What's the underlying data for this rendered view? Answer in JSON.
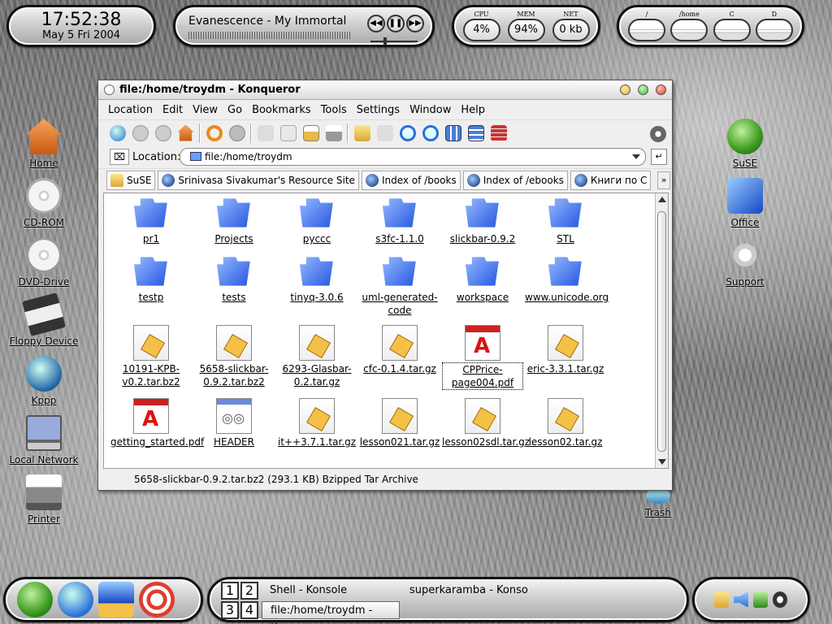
{
  "clock": {
    "time": "17:52:38",
    "date": "May 5 Fri 2004"
  },
  "player": {
    "song": "Evanescence - My Immortal",
    "buttons": [
      "rewind-icon",
      "pause-icon",
      "forward-icon"
    ]
  },
  "meters": [
    {
      "label": "CPU",
      "value": "4%"
    },
    {
      "label": "MEM",
      "value": "94%"
    },
    {
      "label": "NET",
      "value": "0 kb"
    }
  ],
  "disks": [
    {
      "label": "/"
    },
    {
      "label": "/home"
    },
    {
      "label": "C"
    },
    {
      "label": "D"
    }
  ],
  "desktop_left": [
    {
      "label": "Home",
      "icon": "home-icon"
    },
    {
      "label": "CD-ROM",
      "icon": "cdrom-icon"
    },
    {
      "label": "DVD-Drive",
      "icon": "dvd-icon"
    },
    {
      "label": "Floppy Device",
      "icon": "floppy-icon"
    },
    {
      "label": "Kppp",
      "icon": "kppp-icon"
    },
    {
      "label": "Local Network",
      "icon": "network-icon"
    },
    {
      "label": "Printer",
      "icon": "printer-icon"
    }
  ],
  "desktop_right": [
    {
      "label": "SuSE",
      "icon": "suse-icon"
    },
    {
      "label": "Office",
      "icon": "office-icon"
    },
    {
      "label": "Support",
      "icon": "support-icon"
    },
    {
      "label": "Trash",
      "icon": "trash-icon"
    }
  ],
  "window": {
    "title": "file:/home/troydm - Konqueror",
    "menu": [
      "Location",
      "Edit",
      "View",
      "Go",
      "Bookmarks",
      "Tools",
      "Settings",
      "Window",
      "Help"
    ],
    "location_label": "Location:",
    "location_value": "file:/home/troydm",
    "bookmarks": [
      "SuSE",
      "Srinivasa Sivakumar's Resource Site",
      "Index of /books",
      "Index of /ebooks",
      "Книги по С"
    ],
    "status": "5658-slickbar-0.9.2.tar.bz2 (293.1 KB)  Bzipped Tar Archive"
  },
  "files": [
    {
      "name": "pr1",
      "type": "folder"
    },
    {
      "name": "Projects",
      "type": "folder"
    },
    {
      "name": "pyccc",
      "type": "folder"
    },
    {
      "name": "s3fc-1.1.0",
      "type": "folder"
    },
    {
      "name": "slickbar-0.9.2",
      "type": "folder"
    },
    {
      "name": "STL",
      "type": "folder"
    },
    {
      "name": "testp",
      "type": "folder"
    },
    {
      "name": "tests",
      "type": "folder"
    },
    {
      "name": "tinyq-3.0.6",
      "type": "folder"
    },
    {
      "name": "uml-generated-code",
      "type": "folder"
    },
    {
      "name": "workspace",
      "type": "folder"
    },
    {
      "name": "www.unicode.org",
      "type": "folder"
    },
    {
      "name": "10191-KPB-v0.2.tar.bz2",
      "type": "tgz"
    },
    {
      "name": "5658-slickbar-0.9.2.tar.bz2",
      "type": "tgz"
    },
    {
      "name": "6293-Glasbar-0.2.tar.gz",
      "type": "tgz"
    },
    {
      "name": "cfc-0.1.4.tar.gz",
      "type": "tgz"
    },
    {
      "name": "CPPrice-page004.pdf",
      "type": "pdf",
      "selected": true
    },
    {
      "name": "eric-3.3.1.tar.gz",
      "type": "tgz"
    },
    {
      "name": "getting_started.pdf",
      "type": "pdf"
    },
    {
      "name": "HEADER",
      "type": "hdr"
    },
    {
      "name": "it++3.7.1.tar.gz",
      "type": "tgz"
    },
    {
      "name": "lesson021.tar.gz",
      "type": "tgz"
    },
    {
      "name": "lesson02sdl.tar.gz",
      "type": "tgz"
    },
    {
      "name": "lesson02.tar.gz",
      "type": "tgz"
    }
  ],
  "taskbar": {
    "desktops": [
      "1",
      "2",
      "3",
      "4"
    ],
    "tasks": [
      "Shell - Konsole",
      "superkaramba - Konso",
      "file:/home/troydm - Kor"
    ]
  },
  "colors": {
    "accent": "#1e4fe0",
    "close": "#e23c2f",
    "min": "#f2b233",
    "max": "#3cba3c"
  }
}
